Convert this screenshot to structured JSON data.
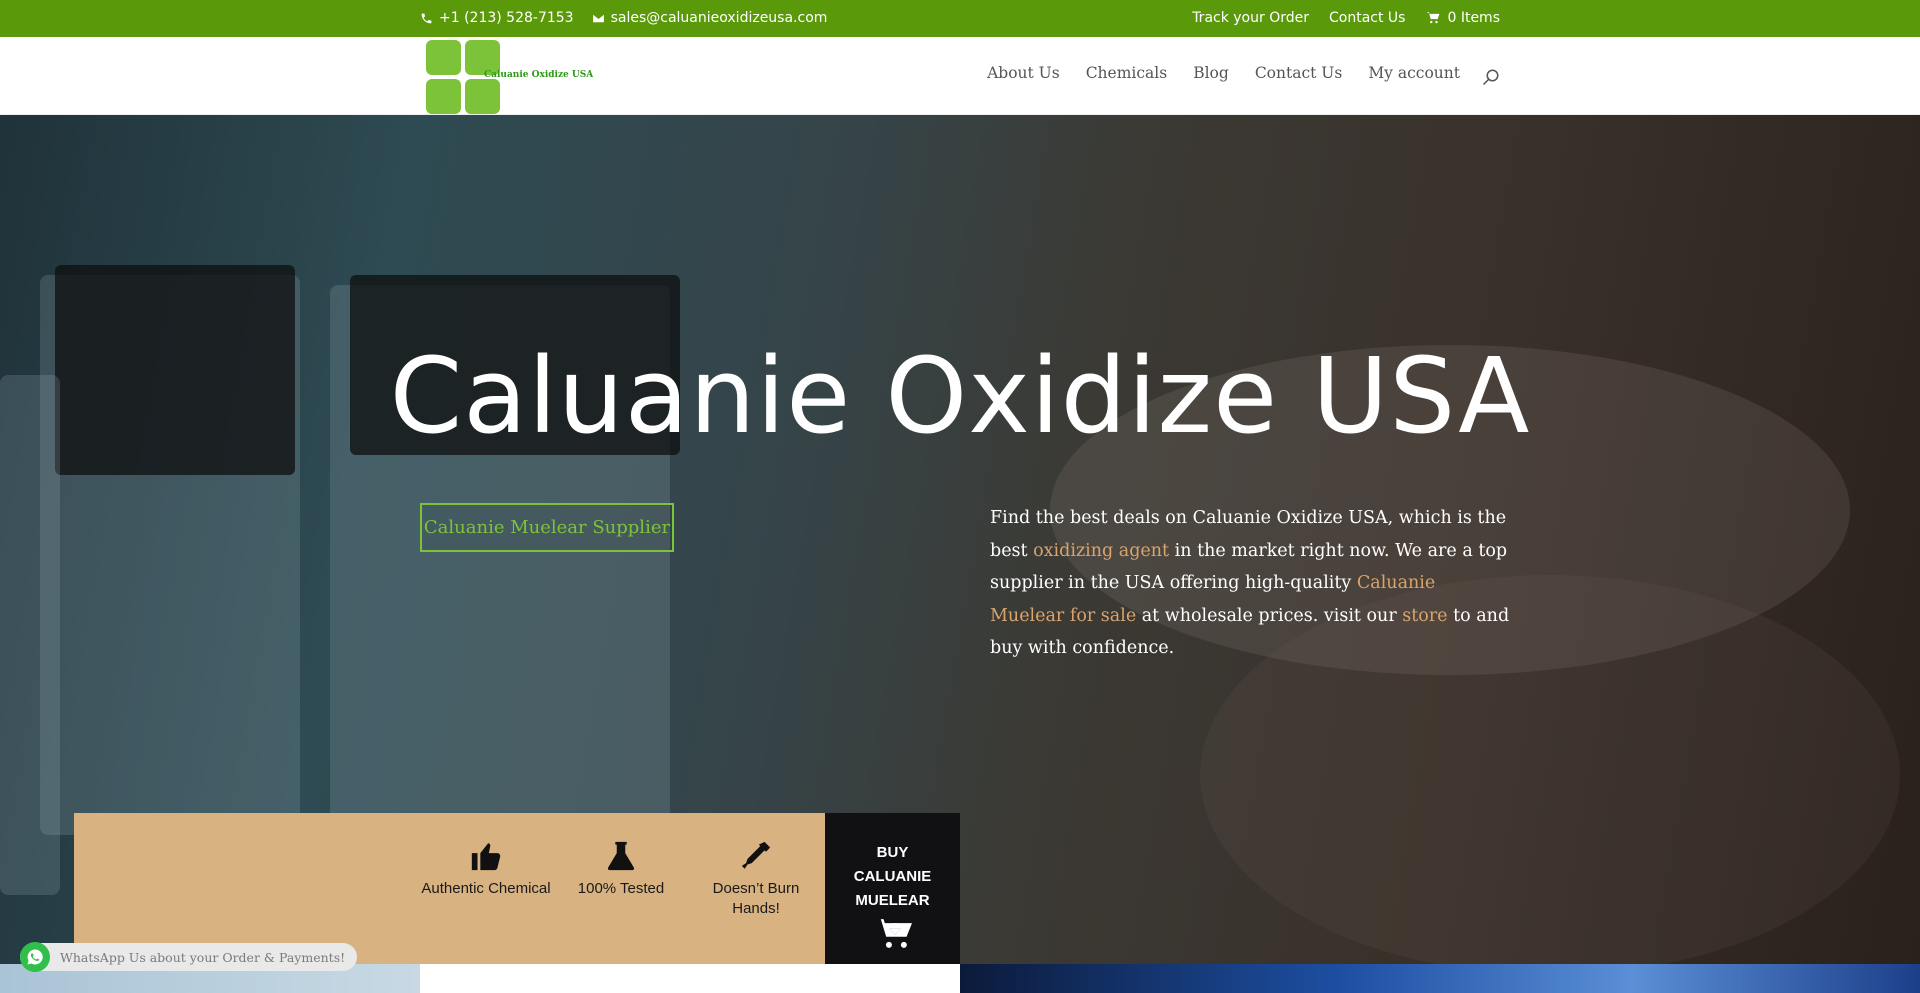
{
  "topbar": {
    "phone": "+1 (213) 528-7153",
    "email": "sales@caluanieoxidizeusa.com",
    "track_order": "Track your Order",
    "contact": "Contact Us",
    "cart": "0 Items"
  },
  "header": {
    "logo_text": "Caluanie Oxidize USA",
    "nav": [
      "About Us",
      "Chemicals",
      "Blog",
      "Contact Us",
      "My account"
    ]
  },
  "hero": {
    "title": "Caluanie Oxidize USA",
    "button": "Caluanie Muelear Supplier",
    "text_1": "Find the best deals on Caluanie Oxidize USA, which is the best ",
    "link_1": "oxidizing agent",
    "text_2": " in the market right now. We are a top supplier in the USA offering high-quality ",
    "link_2": "Caluanie Muelear for sale",
    "text_3": " at wholesale prices. visit our ",
    "link_3": "store",
    "text_4": " to and buy with confidence."
  },
  "features": {
    "authentic": "Authentic Chemical",
    "tested": "100% Tested",
    "no_burn": "Doesn’t Burn Hands!",
    "buy_line1": "BUY",
    "buy_line2": "CALUANIE",
    "buy_line3": "MUELEAR"
  },
  "whatsapp": {
    "label": "WhatsApp Us about your Order & Payments!"
  },
  "colors": {
    "topbar": "#5a9a0a",
    "accent_green": "#7dc33a",
    "link_orange": "#d9a46d",
    "feature_bg": "#d8b280",
    "buy_bg": "#111114"
  }
}
